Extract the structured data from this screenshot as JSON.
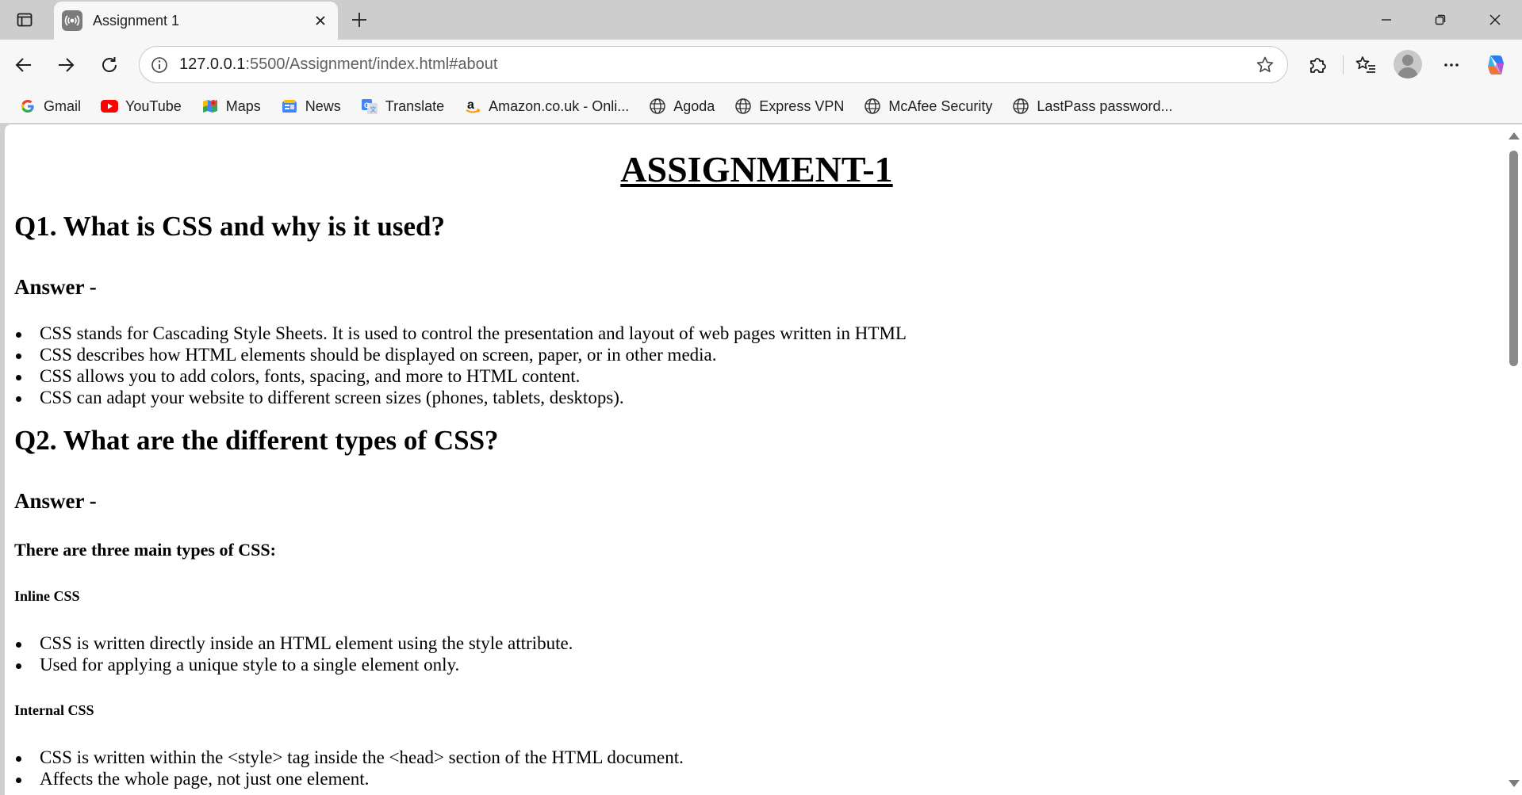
{
  "tab": {
    "title": "Assignment 1"
  },
  "address": {
    "host": "127.0.0.1",
    "path": ":5500/Assignment/index.html#about"
  },
  "bookmarks": [
    {
      "label": "Gmail",
      "icon": "gmail-icon"
    },
    {
      "label": "YouTube",
      "icon": "youtube-icon"
    },
    {
      "label": "Maps",
      "icon": "maps-icon"
    },
    {
      "label": "News",
      "icon": "news-icon"
    },
    {
      "label": "Translate",
      "icon": "translate-icon"
    },
    {
      "label": "Amazon.co.uk - Onli...",
      "icon": "amazon-icon"
    },
    {
      "label": "Agoda",
      "icon": "globe-icon"
    },
    {
      "label": "Express VPN",
      "icon": "globe-icon"
    },
    {
      "label": "McAfee Security",
      "icon": "globe-icon"
    },
    {
      "label": "LastPass password...",
      "icon": "globe-icon"
    }
  ],
  "page": {
    "title": "ASSIGNMENT-1",
    "q1": {
      "question": "Q1. What is CSS and why is it used?",
      "answer_label": "Answer -",
      "points": [
        "CSS stands for Cascading Style Sheets. It is used to control the presentation and layout of web pages written in HTML",
        "CSS describes how HTML elements should be displayed on screen, paper, or in other media.",
        "CSS allows you to add colors, fonts, spacing, and more to HTML content.",
        "CSS can adapt your website to different screen sizes (phones, tablets, desktops)."
      ]
    },
    "q2": {
      "question": "Q2. What are the different types of CSS?",
      "answer_label": "Answer -",
      "intro": "There are three main types of CSS:",
      "inline": {
        "heading": "Inline CSS",
        "points": [
          "CSS is written directly inside an HTML element using the style attribute.",
          "Used for applying a unique style to a single element only."
        ]
      },
      "internal": {
        "heading": "Internal CSS",
        "points": [
          "CSS is written within the <style> tag inside the <head> section of the HTML document.",
          "Affects the whole page, not just one element."
        ]
      }
    }
  },
  "scroll": {
    "position_fraction": 0.0
  }
}
